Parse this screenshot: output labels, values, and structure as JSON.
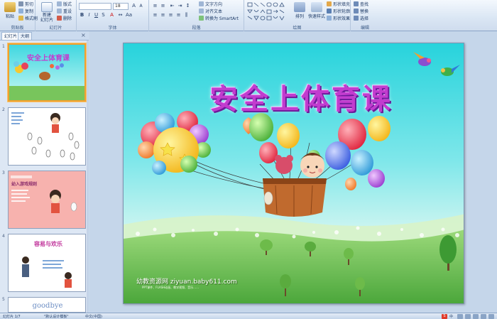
{
  "ribbon": {
    "groups": {
      "clipboard": "剪贴板",
      "slides": "幻灯片",
      "font": "字体",
      "paragraph": "段落",
      "drawing": "绘图",
      "editing": "编辑"
    },
    "clipboard": {
      "paste": "粘贴",
      "cut": "剪切",
      "copy": "复制",
      "format_painter": "格式刷"
    },
    "slides": {
      "new_slide": "新建\n幻灯片",
      "layout": "版式",
      "reset": "重设",
      "delete": "删除"
    },
    "font": {
      "font_name": "",
      "font_size": "18"
    },
    "paragraph": {
      "text_direction": "文字方向",
      "align_text": "对齐文本",
      "smartart": "转换为 SmartArt"
    },
    "drawing": {
      "arrange": "排列",
      "quick_styles": "快速样式",
      "shape_fill": "形状填充",
      "shape_outline": "形状轮廓",
      "shape_effects": "形状效果"
    },
    "editing": {
      "find": "查找",
      "replace": "替换",
      "select": "选择"
    }
  },
  "panel": {
    "tabs": [
      "幻灯片",
      "大纲"
    ],
    "close": "×",
    "thumbs": [
      {
        "num": "1",
        "title": "安全上体育课"
      },
      {
        "num": "2",
        "title": ""
      },
      {
        "num": "3",
        "title": "幼入游戏规则"
      },
      {
        "num": "4",
        "title": "容易与欢乐"
      },
      {
        "num": "5",
        "title": "goodbye"
      }
    ]
  },
  "slide": {
    "title": "安全上体育课",
    "credit": "幼教资源网 ziyuan.baby611.com",
    "credit_sub": "PPT课件、FLASH动画、教学视频、音乐……"
  },
  "status": {
    "slide_num": "幻灯片 1/7",
    "theme": "\"默认设计模板\"",
    "language": "中文(中国)",
    "ime": "中"
  },
  "colors": {
    "ribbon_bg": "#dae6f4",
    "selected_border": "#f0a030",
    "title": "#c23ccf"
  }
}
